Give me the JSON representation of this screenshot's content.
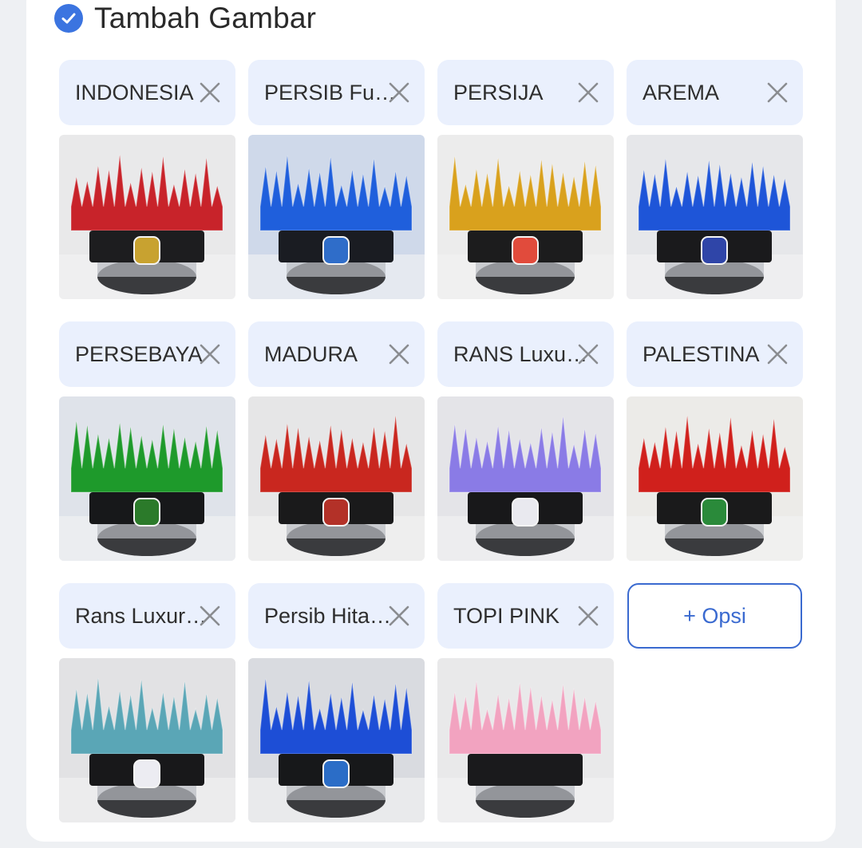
{
  "header": {
    "title": "Tambah Gambar"
  },
  "options": [
    {
      "label": "INDONESIA",
      "hair": "#c8232a",
      "band": "#1d1d1f",
      "badge": "#c8a230",
      "bg": "#e9e9ea"
    },
    {
      "label": "PERSIB Full...",
      "hair": "#1f5fdc",
      "band": "#1a1c22",
      "badge": "#2f6dc9",
      "bg": "#cfd9ea"
    },
    {
      "label": "PERSIJA",
      "hair": "#d9a11d",
      "band": "#1c1c1d",
      "badge": "#e14b3c",
      "bg": "#ececec"
    },
    {
      "label": "AREMA",
      "hair": "#1e55d8",
      "band": "#1a1a1c",
      "badge": "#2f45a8",
      "bg": "#e6e7ea"
    },
    {
      "label": "PERSEBAYA",
      "hair": "#1e9a2b",
      "band": "#17181a",
      "badge": "#2b7a2a",
      "bg": "#dfe3ea"
    },
    {
      "label": "MADURA",
      "hair": "#c9271f",
      "band": "#1a1a1b",
      "badge": "#b33128",
      "bg": "#e6e6e7"
    },
    {
      "label": "RANS Luxury...",
      "hair": "#8a7be6",
      "band": "#18181a",
      "badge": "#e9e9ef",
      "bg": "#e4e4e8"
    },
    {
      "label": "PALESTINA",
      "hair": "#d0201c",
      "band": "#1a1a1b",
      "badge": "#2a8a3a",
      "bg": "#ecebe8"
    },
    {
      "label": "Rans Luxury...",
      "hair": "#5aa6b6",
      "band": "#18181a",
      "badge": "#ececf2",
      "bg": "#e2e2e4"
    },
    {
      "label": "Persib Hitam...",
      "hair": "#1d4ed6",
      "band": "#17181a",
      "badge": "#2b6dc7",
      "bg": "#d9dbe0"
    },
    {
      "label": "TOPI PINK",
      "hair": "#f2a3c0",
      "band": "#1a1a1c",
      "badge": "",
      "bg": "#e9e9ea"
    }
  ],
  "add_button": {
    "label": "+ Opsi"
  },
  "colors": {
    "accent": "#3b74e0",
    "chip_bg": "#eaf0fd"
  }
}
